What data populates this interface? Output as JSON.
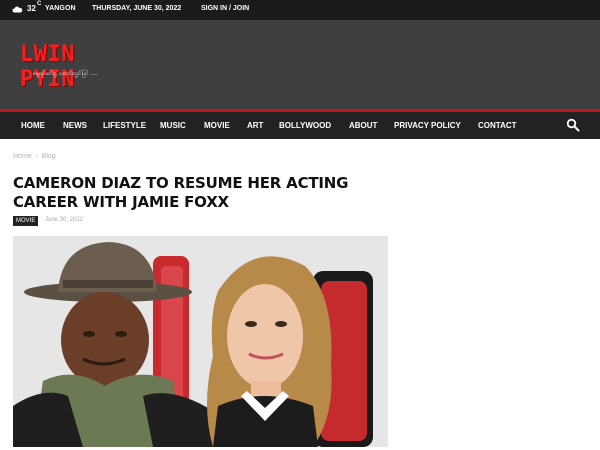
{
  "topbar": {
    "weather_icon": "cloud-icon",
    "temperature": "32",
    "temperature_unit": "C",
    "city": "YANGON",
    "date": "THURSDAY, JUNE 30, 2022",
    "signin": "SIGN IN / JOIN"
  },
  "logo": {
    "text": "LWIN PYIN",
    "tagline": "နေ့စဉ်ဖတ်ရှု သတင်းလွှင်ပြင် ....."
  },
  "nav": {
    "items": [
      "HOME",
      "NEWS",
      "LIFESTYLE",
      "MUSIC",
      "MOVIE",
      "ART",
      "BOLLYWOOD",
      "ABOUT",
      "PRIVACY POLICY",
      "CONTACT"
    ],
    "search_icon": "search-icon"
  },
  "breadcrumb": [
    "Home",
    "Blog"
  ],
  "article": {
    "title": "CAMERON DIAZ TO RESUME HER ACTING CAREER WITH JAMIE FOXX",
    "category": "MOVIE",
    "date": "June 30, 2022"
  },
  "colors": {
    "accent": "#c4161c",
    "logo_red": "#ff1c1c",
    "nav_bg": "#222222",
    "header_bg": "#3f3f3f"
  }
}
